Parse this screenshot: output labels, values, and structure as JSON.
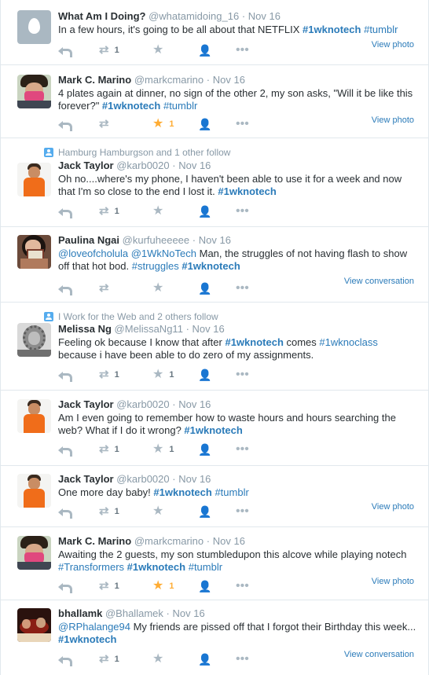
{
  "tweets": [
    {
      "name": "What Am I Doing?",
      "handle": "@whatamidoing_16",
      "time": "Nov 16",
      "text": [
        {
          "t": "In a few hours, it's going to be all about that NETFLIX "
        },
        {
          "t": "#1wknotech",
          "hl": true
        },
        {
          "t": " "
        },
        {
          "t": "#tumblr",
          "hl": true
        }
      ],
      "retweets": "1",
      "favorites": "",
      "link": "View photo"
    },
    {
      "name": "Mark C. Marino",
      "handle": "@markcmarino",
      "time": "Nov 16",
      "text": [
        {
          "t": "4 plates again at dinner, no sign of the other 2, my son asks, \"Will it be like this forever?\" "
        },
        {
          "t": "#1wknotech",
          "hl": true
        },
        {
          "t": " "
        },
        {
          "t": "#tumblr",
          "hl": true
        }
      ],
      "retweets": "",
      "favorites": "1",
      "favorite_active": true,
      "link": "View photo"
    },
    {
      "context": "Hamburg Hamburgson and 1 other follow",
      "name": "Jack Taylor",
      "handle": "@karb0020",
      "time": "Nov 16",
      "text": [
        {
          "t": "Oh no....where's my phone, I haven't been able to use it for a week and now that I'm so close to the end I lost it. "
        },
        {
          "t": "#1wknotech",
          "hl": true
        }
      ],
      "retweets": "1",
      "favorites": "",
      "link": ""
    },
    {
      "name": "Paulina Ngai",
      "handle": "@kurfuheeeee",
      "time": "Nov 16",
      "text": [
        {
          "t": "@loveofcholula",
          "hl": true
        },
        {
          "t": " "
        },
        {
          "t": "@1WkNoTech",
          "hl": true
        },
        {
          "t": " Man, the struggles of not having flash to show off that hot bod. "
        },
        {
          "t": "#struggles",
          "hl": true
        },
        {
          "t": " "
        },
        {
          "t": "#1wknotech",
          "hl": true
        }
      ],
      "retweets": "",
      "favorites": "",
      "link": "View conversation"
    },
    {
      "context": "I Work for the Web and 2 others follow",
      "name": "Melissa Ng",
      "handle": "@MelissaNg11",
      "time": "Nov 16",
      "text": [
        {
          "t": "Feeling ok because I know that after "
        },
        {
          "t": "#1wknotech",
          "hl": true
        },
        {
          "t": " comes "
        },
        {
          "t": "#1wknoclass",
          "hl": true
        },
        {
          "t": " because i have been able to do zero of my assignments."
        }
      ],
      "retweets": "1",
      "favorites": "1",
      "link": ""
    },
    {
      "name": "Jack Taylor",
      "handle": "@karb0020",
      "time": "Nov 16",
      "text": [
        {
          "t": "Am I even going to remember how to waste hours and hours searching the web? What if I do it wrong? "
        },
        {
          "t": "#1wknotech",
          "hl": true
        }
      ],
      "retweets": "1",
      "favorites": "1",
      "link": ""
    },
    {
      "name": "Jack Taylor",
      "handle": "@karb0020",
      "time": "Nov 16",
      "text": [
        {
          "t": "One more day baby! "
        },
        {
          "t": "#1wknotech",
          "hl": true
        },
        {
          "t": " "
        },
        {
          "t": "#tumblr",
          "hl": true
        }
      ],
      "retweets": "1",
      "favorites": "",
      "link": "View photo"
    },
    {
      "name": "Mark C. Marino",
      "handle": "@markcmarino",
      "time": "Nov 16",
      "text": [
        {
          "t": "Awaiting the 2 guests, my son stumbledupon this alcove while playing notech "
        },
        {
          "t": "#Transformers",
          "hl": true
        },
        {
          "t": " "
        },
        {
          "t": "#1wknotech",
          "hl": true
        },
        {
          "t": " "
        },
        {
          "t": "#tumblr",
          "hl": true
        }
      ],
      "retweets": "1",
      "favorites": "1",
      "favorite_active": true,
      "link": "View photo"
    },
    {
      "name": "bhallamk",
      "handle": "@Bhallamek",
      "time": "Nov 16",
      "text": [
        {
          "t": "@RPhalange94",
          "hl": true
        },
        {
          "t": " My friends are pissed off that I forgot their Birthday this week... "
        },
        {
          "t": "#1wknotech",
          "hl": true
        }
      ],
      "retweets": "1",
      "favorites": "",
      "link": "View conversation"
    }
  ],
  "icons": {
    "reply": "reply-icon",
    "retweet": "retweet-icon",
    "favorite": "star-icon",
    "follow": "follow-icon",
    "more": "more-icon",
    "context": "user-badge-icon"
  },
  "colors": {
    "link": "#2b7bb9",
    "muted": "#8899a6",
    "favorite_active": "#ffac33",
    "border": "#e1e8ed"
  }
}
